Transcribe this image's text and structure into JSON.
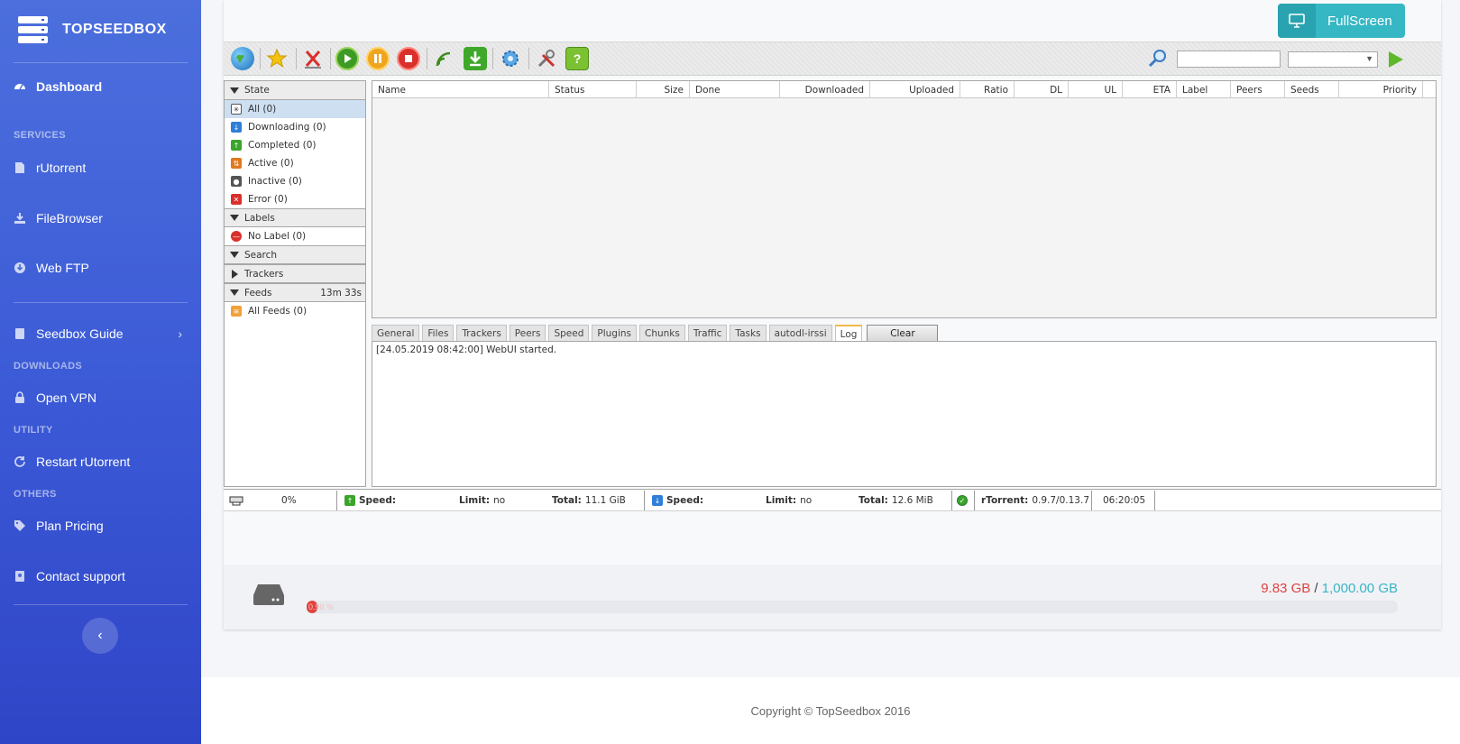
{
  "brand": {
    "name": "TOPSEEDBOX"
  },
  "sidebar": {
    "items": [
      {
        "label": "Dashboard",
        "icon": "dashboard-icon"
      },
      {
        "label": "rUtorrent",
        "icon": "file-icon"
      },
      {
        "label": "FileBrowser",
        "icon": "download-icon"
      },
      {
        "label": "Web FTP",
        "icon": "arrow-down-circle-icon"
      },
      {
        "label": "Seedbox Guide",
        "icon": "book-icon"
      },
      {
        "label": "Open VPN",
        "icon": "lock-icon"
      },
      {
        "label": "Restart rUtorrent",
        "icon": "refresh-icon"
      },
      {
        "label": "Plan Pricing",
        "icon": "tag-icon"
      },
      {
        "label": "Contact support",
        "icon": "contact-icon"
      }
    ],
    "headings": {
      "services": "SERVICES",
      "downloads": "DOWNLOADS",
      "utility": "UTILITY",
      "others": "OTHERS"
    }
  },
  "header": {
    "fullscreen_label": "FullScreen"
  },
  "toolbar": {
    "search_value": "",
    "select_value": "",
    "buttons": [
      "globe-icon",
      "star-icon",
      "remove-icon",
      "start-icon",
      "pause-icon",
      "stop-icon",
      "rss-icon",
      "download-icon",
      "settings-icon",
      "tools-icon",
      "help-icon"
    ]
  },
  "categories": {
    "state_title": "State",
    "state_items": [
      {
        "label": "All (0)",
        "icon": "all-icon"
      },
      {
        "label": "Downloading (0)",
        "icon": "downloading-icon"
      },
      {
        "label": "Completed (0)",
        "icon": "completed-icon"
      },
      {
        "label": "Active (0)",
        "icon": "active-icon"
      },
      {
        "label": "Inactive (0)",
        "icon": "inactive-icon"
      },
      {
        "label": "Error (0)",
        "icon": "error-icon"
      }
    ],
    "labels_title": "Labels",
    "labels_items": [
      {
        "label": "No Label (0)",
        "icon": "no-label-icon"
      }
    ],
    "search_title": "Search",
    "trackers_title": "Trackers",
    "feeds_title": "Feeds",
    "feeds_timer": "13m 33s",
    "feeds_items": [
      {
        "label": "All Feeds (0)",
        "icon": "rss-icon"
      }
    ]
  },
  "table": {
    "columns": [
      "Name",
      "Status",
      "Size",
      "Done",
      "Downloaded",
      "Uploaded",
      "Ratio",
      "DL",
      "UL",
      "ETA",
      "Label",
      "Peers",
      "Seeds",
      "Priority"
    ]
  },
  "tabs": {
    "items": [
      "General",
      "Files",
      "Trackers",
      "Peers",
      "Speed",
      "Plugins",
      "Chunks",
      "Traffic",
      "Tasks",
      "autodl-irssi",
      "Log"
    ],
    "active": "Log",
    "clear_label": "Clear"
  },
  "log": {
    "lines": [
      "[24.05.2019 08:42:00] WebUI started."
    ]
  },
  "status": {
    "disk_percent": "0%",
    "ul_speed_label": "Speed:",
    "ul_speed_value": "",
    "ul_limit_label": "Limit:",
    "ul_limit_value": "no",
    "ul_total_label": "Total:",
    "ul_total_value": "11.1 GiB",
    "dl_speed_label": "Speed:",
    "dl_speed_value": "",
    "dl_limit_label": "Limit:",
    "dl_limit_value": "no",
    "dl_total_label": "Total:",
    "dl_total_value": "12.6 MiB",
    "client_label": "rTorrent:",
    "client_value": "0.9.7/0.13.7",
    "uptime": "06:20:05"
  },
  "disk": {
    "used": "9.83 GB",
    "separator": "/",
    "total": "1,000.00 GB",
    "percent_label": "0.98 %",
    "fill_fraction": 0.0098,
    "used_color": "#e0433f",
    "total_color": "#35b7c4"
  },
  "footer": {
    "copyright": "Copyright © TopSeedbox 2016"
  }
}
